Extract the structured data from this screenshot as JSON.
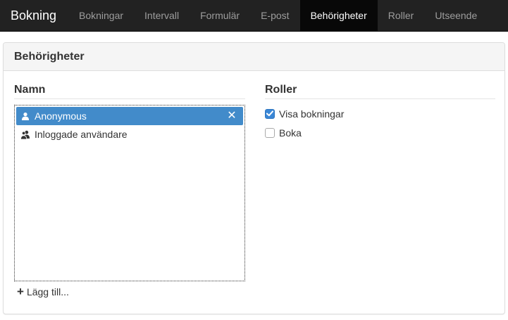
{
  "nav": {
    "brand": "Bokning",
    "items": [
      {
        "label": "Bokningar",
        "active": false
      },
      {
        "label": "Intervall",
        "active": false
      },
      {
        "label": "Formulär",
        "active": false
      },
      {
        "label": "E-post",
        "active": false
      },
      {
        "label": "Behörigheter",
        "active": true
      },
      {
        "label": "Roller",
        "active": false
      },
      {
        "label": "Utseende",
        "active": false
      }
    ]
  },
  "panel": {
    "title": "Behörigheter",
    "names": {
      "title": "Namn",
      "items": [
        {
          "label": "Anonymous",
          "icon": "user-icon",
          "selected": true,
          "remove": "✕"
        },
        {
          "label": "Inloggade användare",
          "icon": "users-icon",
          "selected": false
        }
      ],
      "add_label": "Lägg till..."
    },
    "roles": {
      "title": "Roller",
      "items": [
        {
          "label": "Visa bokningar",
          "checked": true
        },
        {
          "label": "Boka",
          "checked": false
        }
      ]
    }
  },
  "colors": {
    "navbar_bg": "#222222",
    "nav_active_bg": "#080808",
    "selected_bg": "#428bca",
    "checkbox_checked": "#3a87d6"
  }
}
